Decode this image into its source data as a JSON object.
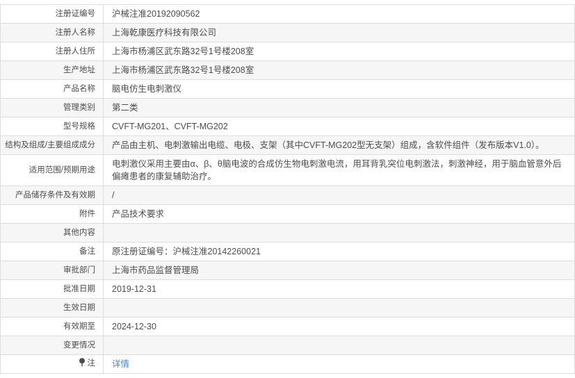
{
  "colors": {
    "link": "#3a87d4",
    "stripe": "#f6f6f6",
    "border": "#dcdcdc",
    "text": "#4d4d4d"
  },
  "table": {
    "rows": [
      {
        "label": "注册证编号",
        "value": "沪械注准20192090562"
      },
      {
        "label": "注册人名称",
        "value": "上海乾康医疗科技有限公司"
      },
      {
        "label": "注册人住所",
        "value": "上海市杨浦区武东路32号1号楼208室"
      },
      {
        "label": "生产地址",
        "value": "上海市杨浦区武东路32号1号楼208室"
      },
      {
        "label": "产品名称",
        "value": "脑电仿生电刺激仪"
      },
      {
        "label": "管理类别",
        "value": "第二类"
      },
      {
        "label": "型号规格",
        "value": "CVFT-MG201、CVFT-MG202"
      },
      {
        "label": "结构及组成/主要组成成分",
        "value": "产品由主机、电刺激输出电缆、电极、支架（其中CVFT-MG202型无支架）组成，含软件组件（发布版本V1.0）。"
      },
      {
        "label": "适用范围/预期用途",
        "value": "电刺激仪采用主要由α、β、θ脑电波的合成仿生物电刺激电流，用耳背乳突位电刺激法，刺激神经，用于脑血管意外后偏瘫患者的康复辅助治疗。"
      },
      {
        "label": "产品储存条件及有效期",
        "value": "/"
      },
      {
        "label": "附件",
        "value": "产品技术要求"
      },
      {
        "label": "其他内容",
        "value": ""
      },
      {
        "label": "备注",
        "value": "原注册证编号：沪械注准20142260021"
      },
      {
        "label": "审批部门",
        "value": "上海市药品监督管理局"
      },
      {
        "label": "批准日期",
        "value": "2019-12-31"
      },
      {
        "label": "生效日期",
        "value": ""
      },
      {
        "label": "有效期至",
        "value": "2024-12-30"
      },
      {
        "label": "变更情况",
        "value": ""
      },
      {
        "label": "注",
        "value": "详情",
        "link": true,
        "icon": "pin-icon"
      }
    ]
  }
}
